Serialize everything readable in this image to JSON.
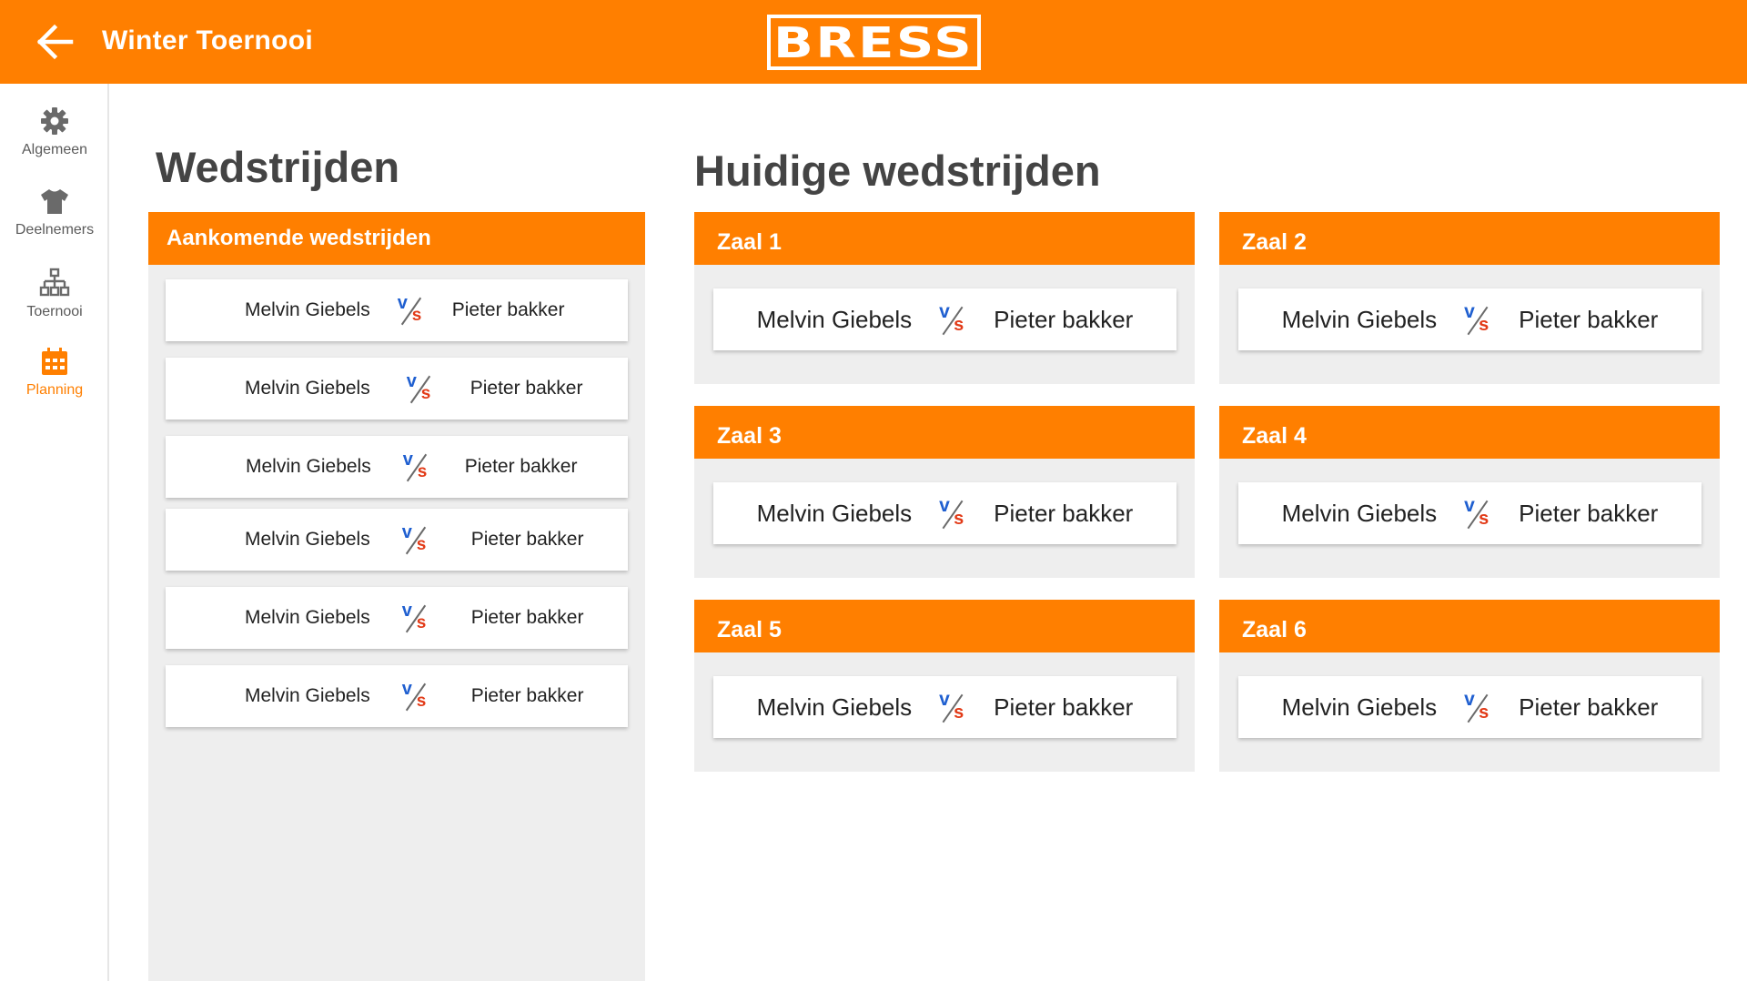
{
  "header": {
    "title": "Winter Toernooi",
    "logo_text": "BRESS",
    "back_icon": "arrow-left-icon",
    "color": "#ff7f00"
  },
  "sidebar": {
    "items": [
      {
        "label": "Algemeen",
        "icon": "gear-icon",
        "active": false
      },
      {
        "label": "Deelnemers",
        "icon": "tshirt-icon",
        "active": false
      },
      {
        "label": "Toernooi",
        "icon": "bracket-icon",
        "active": false
      },
      {
        "label": "Planning",
        "icon": "calendar-icon",
        "active": true
      }
    ]
  },
  "matches": {
    "title": "Wedstrijden",
    "upcoming_title": "Aankomende wedstrijden",
    "upcoming": [
      {
        "home": "Melvin Giebels",
        "away": "Pieter bakker"
      },
      {
        "home": "Melvin Giebels",
        "away": "Pieter bakker"
      },
      {
        "home": "Melvin Giebels",
        "away": "Pieter bakker"
      },
      {
        "home": "Melvin Giebels",
        "away": "Pieter bakker"
      },
      {
        "home": "Melvin Giebels",
        "away": "Pieter bakker"
      },
      {
        "home": "Melvin Giebels",
        "away": "Pieter bakker"
      }
    ]
  },
  "current": {
    "title": "Huidige wedstrijden",
    "halls": [
      {
        "name": "Zaal 1",
        "home": "Melvin Giebels",
        "away": "Pieter bakker"
      },
      {
        "name": "Zaal 2",
        "home": "Melvin Giebels",
        "away": "Pieter bakker"
      },
      {
        "name": "Zaal 3",
        "home": "Melvin Giebels",
        "away": "Pieter bakker"
      },
      {
        "name": "Zaal 4",
        "home": "Melvin Giebels",
        "away": "Pieter bakker"
      },
      {
        "name": "Zaal 5",
        "home": "Melvin Giebels",
        "away": "Pieter bakker"
      },
      {
        "name": "Zaal 6",
        "home": "Melvin Giebels",
        "away": "Pieter bakker"
      }
    ]
  },
  "vs": {
    "v": "v",
    "s": "s",
    "v_color": "#1f5fd0",
    "s_color": "#e23a17"
  }
}
